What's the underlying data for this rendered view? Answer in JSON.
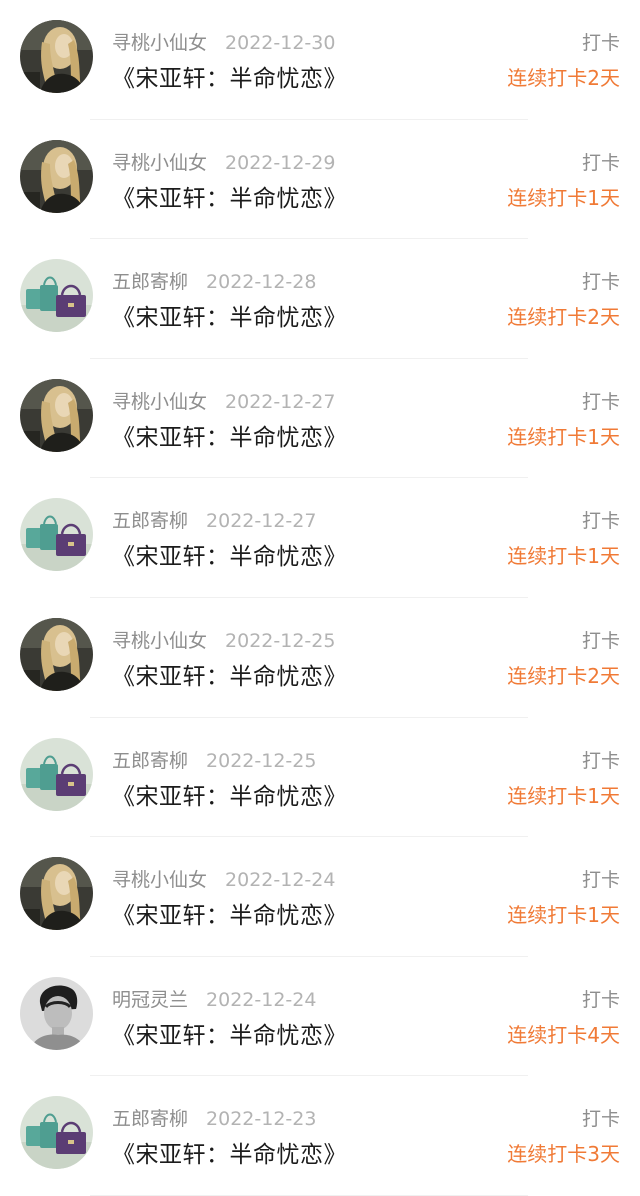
{
  "colors": {
    "accent": "#f07a36",
    "name": "#8e8e8e",
    "date": "#b3b3b3",
    "title": "#1c1c1c"
  },
  "entries": [
    {
      "user": "寻桃小仙女",
      "date": "2022-12-30",
      "title": "《宋亚轩：半命忧恋》",
      "action": "打卡",
      "streak": "连续打卡2天",
      "avatar_icon": "blonde-woman-avatar-icon"
    },
    {
      "user": "寻桃小仙女",
      "date": "2022-12-29",
      "title": "《宋亚轩：半命忧恋》",
      "action": "打卡",
      "streak": "连续打卡1天",
      "avatar_icon": "blonde-woman-avatar-icon"
    },
    {
      "user": "五郎寄柳",
      "date": "2022-12-28",
      "title": "《宋亚轩：半命忧恋》",
      "action": "打卡",
      "streak": "连续打卡2天",
      "avatar_icon": "bags-avatar-icon"
    },
    {
      "user": "寻桃小仙女",
      "date": "2022-12-27",
      "title": "《宋亚轩：半命忧恋》",
      "action": "打卡",
      "streak": "连续打卡1天",
      "avatar_icon": "blonde-woman-avatar-icon"
    },
    {
      "user": "五郎寄柳",
      "date": "2022-12-27",
      "title": "《宋亚轩：半命忧恋》",
      "action": "打卡",
      "streak": "连续打卡1天",
      "avatar_icon": "bags-avatar-icon"
    },
    {
      "user": "寻桃小仙女",
      "date": "2022-12-25",
      "title": "《宋亚轩：半命忧恋》",
      "action": "打卡",
      "streak": "连续打卡2天",
      "avatar_icon": "blonde-woman-avatar-icon"
    },
    {
      "user": "五郎寄柳",
      "date": "2022-12-25",
      "title": "《宋亚轩：半命忧恋》",
      "action": "打卡",
      "streak": "连续打卡1天",
      "avatar_icon": "bags-avatar-icon"
    },
    {
      "user": "寻桃小仙女",
      "date": "2022-12-24",
      "title": "《宋亚轩：半命忧恋》",
      "action": "打卡",
      "streak": "连续打卡1天",
      "avatar_icon": "blonde-woman-avatar-icon"
    },
    {
      "user": "明冠灵兰",
      "date": "2022-12-24",
      "title": "《宋亚轩：半命忧恋》",
      "action": "打卡",
      "streak": "连续打卡4天",
      "avatar_icon": "man-portrait-avatar-icon"
    },
    {
      "user": "五郎寄柳",
      "date": "2022-12-23",
      "title": "《宋亚轩：半命忧恋》",
      "action": "打卡",
      "streak": "连续打卡3天",
      "avatar_icon": "bags-avatar-icon"
    }
  ]
}
